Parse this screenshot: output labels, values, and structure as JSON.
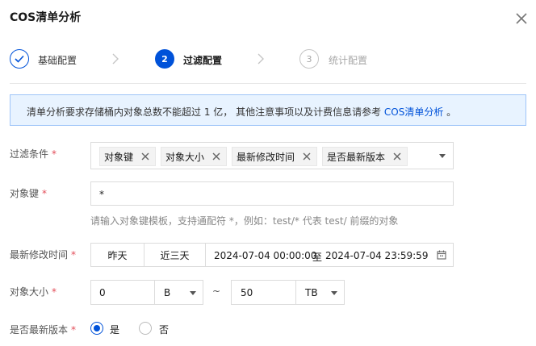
{
  "dialog": {
    "title": "COS清单分析"
  },
  "steps": [
    {
      "number": "1",
      "label": "基础配置",
      "state": "done"
    },
    {
      "number": "2",
      "label": "过滤配置",
      "state": "active"
    },
    {
      "number": "3",
      "label": "统计配置",
      "state": "todo"
    }
  ],
  "notice": {
    "text": "清单分析要求存储桶内对象总数不能超过 1 亿， 其他注意事项以及计费信息请参考 ",
    "link": "COS清单分析",
    "suffix": " 。"
  },
  "filter_conditions": {
    "label": "过滤条件",
    "required_mark": "*",
    "tags": [
      "对象键",
      "对象大小",
      "最新修改时间",
      "是否最新版本"
    ]
  },
  "object_key": {
    "label": "对象键",
    "required_mark": "*",
    "value": "*",
    "hint": "请输入对象键模板，支持通配符 *，例如：test/* 代表 test/ 前缀的对象"
  },
  "last_modified": {
    "label": "最新修改时间",
    "required_mark": "*",
    "quick_buttons": [
      "昨天",
      "近三天"
    ],
    "start": "2024-07-04 00:00:00",
    "separator": "至",
    "end": "2024-07-04 23:59:59"
  },
  "object_size": {
    "label": "对象大小",
    "required_mark": "*",
    "min_value": "0",
    "min_unit": "B",
    "range_separator": "~",
    "max_value": "50",
    "max_unit": "TB"
  },
  "latest_version": {
    "label": "是否最新版本",
    "required_mark": "*",
    "options": [
      {
        "label": "是",
        "selected": true
      },
      {
        "label": "否",
        "selected": false
      }
    ]
  },
  "colors": {
    "brand": "#0052d9",
    "required": "#e34d59",
    "notice_bg": "#e8f3ff"
  }
}
